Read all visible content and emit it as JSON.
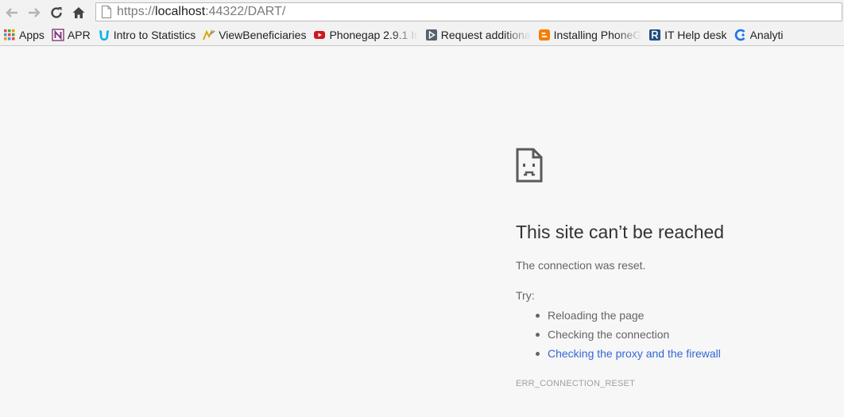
{
  "browser": {
    "url": {
      "scheme": "https://",
      "host": "localhost",
      "rest": ":44322/DART/"
    },
    "bookmarks": [
      {
        "label": "Apps",
        "icon": "apps-grid-icon"
      },
      {
        "label": "APR",
        "icon": "onenote-icon"
      },
      {
        "label": "Intro to Statistics",
        "icon": "udacity-icon"
      },
      {
        "label": "ViewBeneficiaries",
        "icon": "beneficiaries-icon"
      },
      {
        "label": "Phonegap 2.9.1 Ir",
        "icon": "youtube-icon"
      },
      {
        "label": "Request additiona",
        "icon": "request-icon"
      },
      {
        "label": "Installing PhoneG",
        "icon": "blogger-icon"
      },
      {
        "label": "IT Help desk",
        "icon": "helpdesk-icon"
      },
      {
        "label": "Analyti",
        "icon": "analytics-icon"
      }
    ]
  },
  "error": {
    "icon": "sad-page-icon",
    "headline": "This site can’t be reached",
    "description": "The connection was reset.",
    "try_label": "Try:",
    "suggestions": [
      "Reloading the page",
      "Checking the connection",
      "Checking the proxy and the firewall"
    ],
    "code": "ERR_CONNECTION_RESET",
    "colors": {
      "link": "#3367d6",
      "text": "#646464",
      "headline": "#333333"
    }
  }
}
